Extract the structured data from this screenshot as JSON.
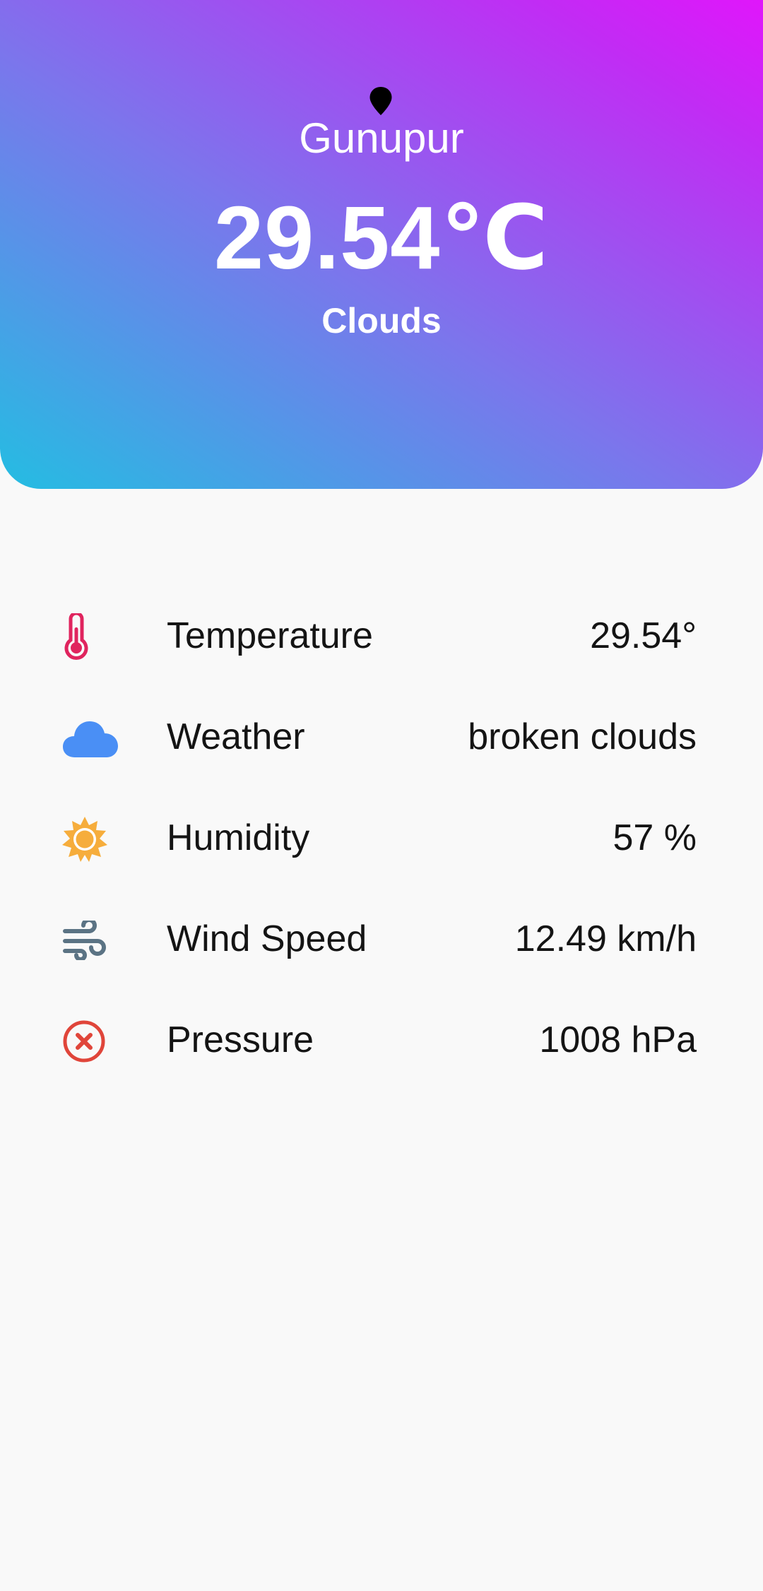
{
  "header": {
    "city": "Gunupur",
    "temperature": "29.54℃",
    "condition": "Clouds",
    "gradient_colors": [
      "#24bde2",
      "#7c75ec",
      "#c12cf4",
      "#e016fb"
    ]
  },
  "details": [
    {
      "label": "Temperature",
      "value": "29.54°",
      "icon": "thermometer-icon",
      "icon_color": "#e0245e"
    },
    {
      "label": "Weather",
      "value": "broken clouds",
      "icon": "cloud-icon",
      "icon_color": "#4a8ff5"
    },
    {
      "label": "Humidity",
      "value": "57 %",
      "icon": "sun-icon",
      "icon_color": "#f6ad3c"
    },
    {
      "label": "Wind Speed",
      "value": "12.49 km/h",
      "icon": "wind-icon",
      "icon_color": "#5b7384"
    },
    {
      "label": "Pressure",
      "value": "1008 hPa",
      "icon": "close-circle-icon",
      "icon_color": "#e0453a"
    }
  ]
}
